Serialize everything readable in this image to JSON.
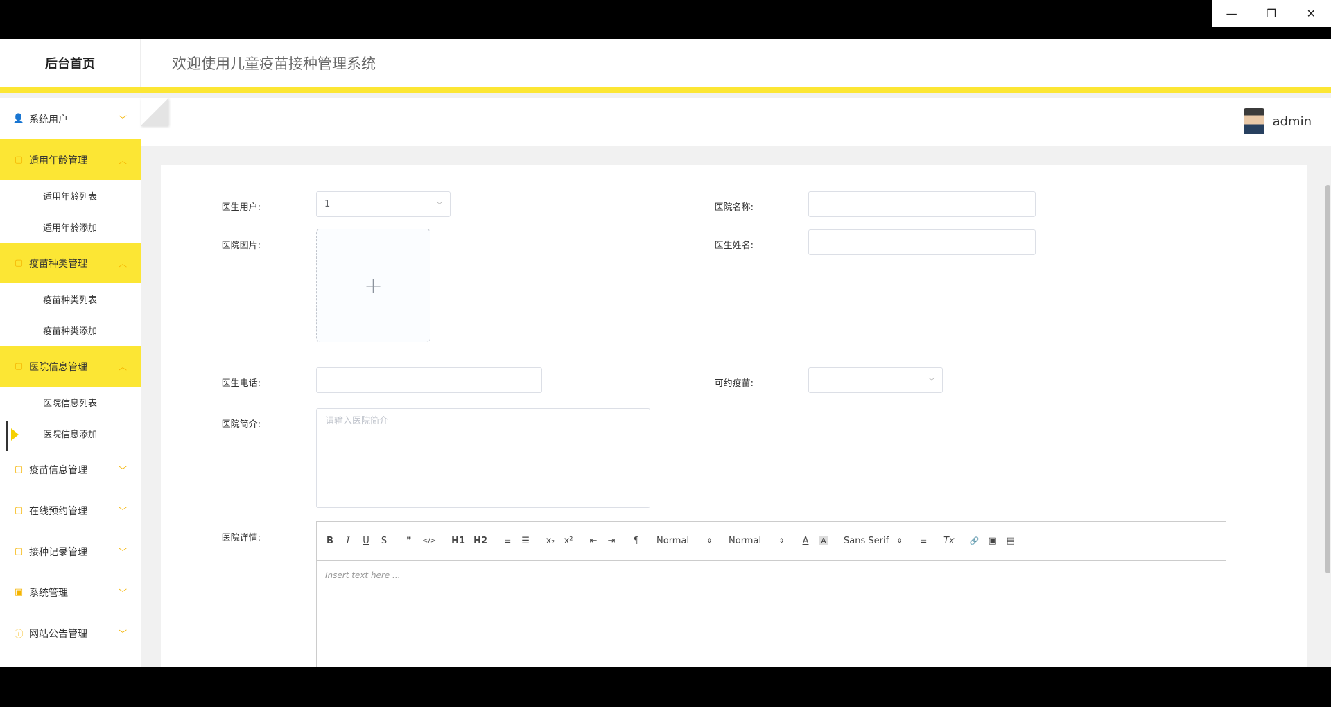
{
  "window": {
    "minimize": "—",
    "restore": "❐",
    "close": "✕"
  },
  "header": {
    "brand": "后台首页",
    "welcome": "欢迎使用儿童疫苗接种管理系统"
  },
  "user": {
    "name": "admin"
  },
  "sidebar": {
    "items": [
      {
        "label": "系统用户",
        "icon": "user-icon",
        "state": "collapsed"
      },
      {
        "label": "适用年龄管理",
        "icon": "folder-icon",
        "state": "open",
        "children": [
          "适用年龄列表",
          "适用年龄添加"
        ]
      },
      {
        "label": "疫苗种类管理",
        "icon": "folder-icon",
        "state": "open",
        "children": [
          "疫苗种类列表",
          "疫苗种类添加"
        ]
      },
      {
        "label": "医院信息管理",
        "icon": "folder-icon",
        "state": "open",
        "children": [
          "医院信息列表",
          "医院信息添加"
        ]
      },
      {
        "label": "疫苗信息管理",
        "icon": "folder-icon",
        "state": "collapsed"
      },
      {
        "label": "在线预约管理",
        "icon": "folder-icon",
        "state": "collapsed"
      },
      {
        "label": "接种记录管理",
        "icon": "folder-icon",
        "state": "collapsed"
      },
      {
        "label": "系统管理",
        "icon": "image-icon",
        "state": "collapsed"
      },
      {
        "label": "网站公告管理",
        "icon": "info-icon",
        "state": "collapsed"
      }
    ]
  },
  "form": {
    "doctor_user": {
      "label": "医生用户:",
      "value": "1"
    },
    "hospital_name": {
      "label": "医院名称:",
      "value": ""
    },
    "hospital_image": {
      "label": "医院图片:",
      "upload_glyph": "+"
    },
    "doctor_name": {
      "label": "医生姓名:",
      "value": ""
    },
    "doctor_phone": {
      "label": "医生电话:",
      "value": ""
    },
    "vaccine": {
      "label": "可约疫苗:",
      "value": ""
    },
    "intro": {
      "label": "医院简介:",
      "placeholder": "请输入医院简介"
    },
    "detail": {
      "label": "医院详情:",
      "placeholder": "Insert text here ..."
    }
  },
  "editor_toolbar": {
    "bold": "B",
    "italic": "I",
    "underline": "U",
    "strike": "S",
    "quote": "❞",
    "code": "</>",
    "h1": "H1",
    "h2": "H2",
    "ordered": "≡",
    "bullet": "☰",
    "sub": "x₂",
    "sup": "x²",
    "outdent": "⇤",
    "indent": "⇥",
    "direction": "¶",
    "size": "Normal",
    "header": "Normal",
    "color": "A",
    "background": "A",
    "font": "Sans Serif",
    "align": "≡",
    "clean": "Tx",
    "link": "🔗",
    "image": "▣",
    "video": "▤"
  }
}
